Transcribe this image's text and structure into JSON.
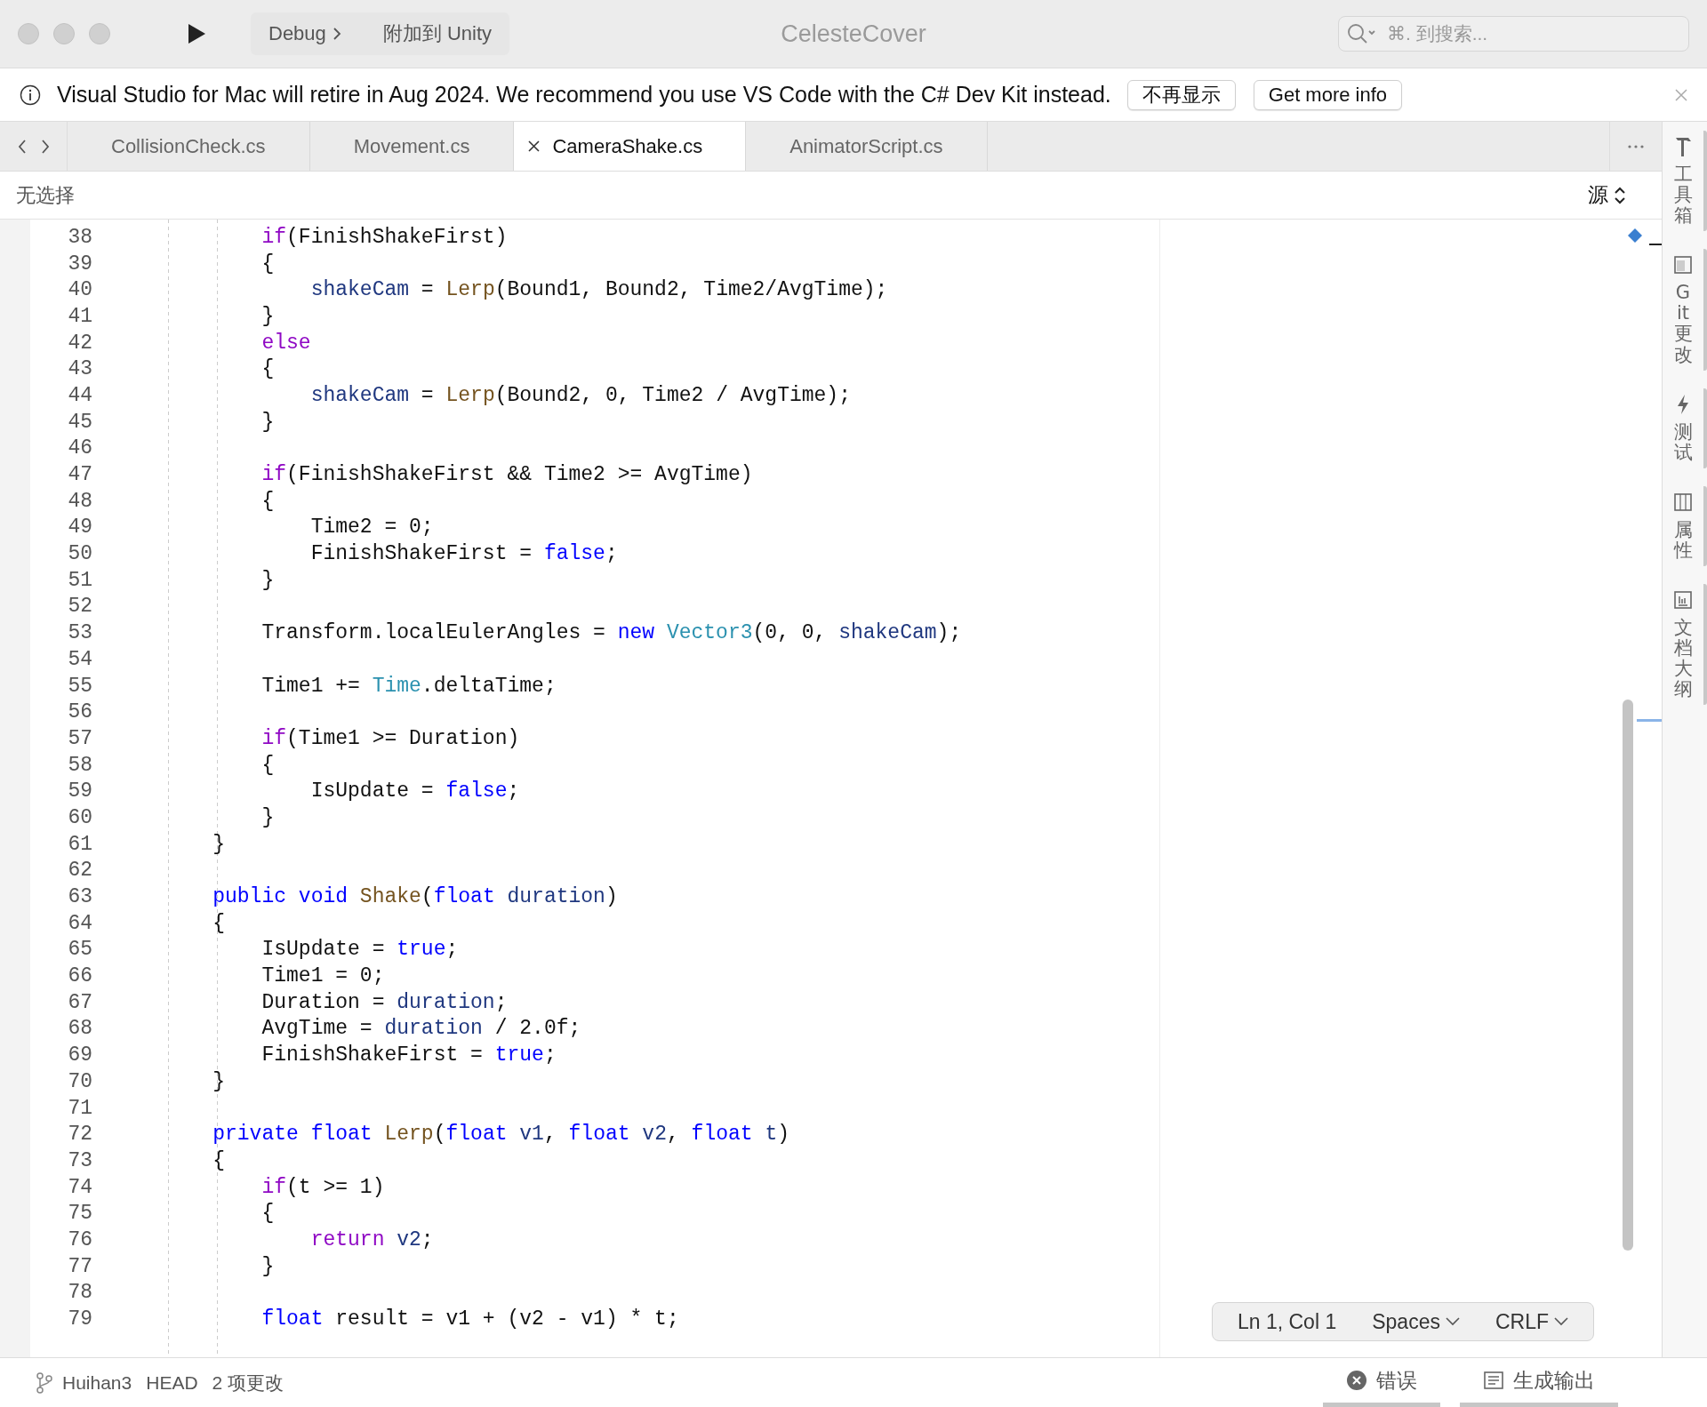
{
  "title_bar": {
    "run_target": "Debug",
    "attach": "附加到 Unity",
    "title": "CelesteCover",
    "search": {
      "placeholder": "⌘. 到搜索..."
    }
  },
  "banner": {
    "message": "Visual Studio for Mac will retire in Aug 2024. We recommend you use VS Code with the C# Dev Kit instead.",
    "buttons": [
      "不再显示",
      "Get more info"
    ]
  },
  "tabs": [
    {
      "label": "CollisionCheck.cs",
      "selected": false
    },
    {
      "label": "Movement.cs",
      "selected": false
    },
    {
      "label": "CameraShake.cs",
      "selected": true
    },
    {
      "label": "AnimatorScript.cs",
      "selected": false
    }
  ],
  "breadcrumb": {
    "selection": "无选择",
    "view": "源"
  },
  "code_lines": [
    {
      "number": "38",
      "tokens": [
        {
          "kind": "kw",
          "text": "        if"
        },
        {
          "kind": "txt",
          "text": "(FinishShakeFirst)"
        }
      ]
    },
    {
      "number": "39",
      "tokens": [
        {
          "kind": "txt",
          "text": "        {"
        }
      ]
    },
    {
      "number": "40",
      "tokens": [
        {
          "kind": "var",
          "text": "            shakeCam"
        },
        {
          "kind": "txt",
          "text": " = "
        },
        {
          "kind": "fn",
          "text": "Lerp"
        },
        {
          "kind": "txt",
          "text": "(Bound1, Bound2, Time2/AvgTime);"
        }
      ]
    },
    {
      "number": "41",
      "tokens": [
        {
          "kind": "txt",
          "text": "        }"
        }
      ]
    },
    {
      "number": "42",
      "tokens": [
        {
          "kind": "kw",
          "text": "        else"
        }
      ]
    },
    {
      "number": "43",
      "tokens": [
        {
          "kind": "txt",
          "text": "        {"
        }
      ]
    },
    {
      "number": "44",
      "tokens": [
        {
          "kind": "var",
          "text": "            shakeCam"
        },
        {
          "kind": "txt",
          "text": " = "
        },
        {
          "kind": "fn",
          "text": "Lerp"
        },
        {
          "kind": "txt",
          "text": "(Bound2, 0, Time2 / AvgTime);"
        }
      ]
    },
    {
      "number": "45",
      "tokens": [
        {
          "kind": "txt",
          "text": "        }"
        }
      ]
    },
    {
      "number": "46"
    },
    {
      "number": "47",
      "tokens": [
        {
          "kind": "kw",
          "text": "        if"
        },
        {
          "kind": "txt",
          "text": "(FinishShakeFirst && Time2 >= AvgTime)"
        }
      ]
    },
    {
      "number": "48",
      "tokens": [
        {
          "kind": "txt",
          "text": "        {"
        }
      ]
    },
    {
      "number": "49",
      "tokens": [
        {
          "kind": "txt",
          "text": "            Time2 = 0;"
        }
      ]
    },
    {
      "number": "50",
      "tokens": [
        {
          "kind": "txt",
          "text": "            FinishShakeFirst = "
        },
        {
          "kind": "key",
          "text": "false"
        },
        {
          "kind": "txt",
          "text": ";"
        }
      ]
    },
    {
      "number": "51",
      "tokens": [
        {
          "kind": "txt",
          "text": "        }"
        }
      ]
    },
    {
      "number": "52"
    },
    {
      "number": "53",
      "tokens": [
        {
          "kind": "txt",
          "text": "        Transform.localEulerAngles = "
        },
        {
          "kind": "key",
          "text": "new "
        },
        {
          "kind": "cls",
          "text": "Vector3"
        },
        {
          "kind": "txt",
          "text": "(0, 0, "
        },
        {
          "kind": "var",
          "text": "shakeCam"
        },
        {
          "kind": "txt",
          "text": ");"
        }
      ]
    },
    {
      "number": "54"
    },
    {
      "number": "55",
      "tokens": [
        {
          "kind": "txt",
          "text": "        Time1 += "
        },
        {
          "kind": "cls",
          "text": "Time"
        },
        {
          "kind": "txt",
          "text": ".deltaTime;"
        }
      ]
    },
    {
      "number": "56"
    },
    {
      "number": "57",
      "tokens": [
        {
          "kind": "kw",
          "text": "        if"
        },
        {
          "kind": "txt",
          "text": "(Time1 >= Duration)"
        }
      ]
    },
    {
      "number": "58",
      "tokens": [
        {
          "kind": "txt",
          "text": "        {"
        }
      ]
    },
    {
      "number": "59",
      "tokens": [
        {
          "kind": "txt",
          "text": "            IsUpdate = "
        },
        {
          "kind": "key",
          "text": "false"
        },
        {
          "kind": "txt",
          "text": ";"
        }
      ]
    },
    {
      "number": "60",
      "tokens": [
        {
          "kind": "txt",
          "text": "        }"
        }
      ]
    },
    {
      "number": "61",
      "tokens": [
        {
          "kind": "txt",
          "text": "    }"
        }
      ]
    },
    {
      "number": "62"
    },
    {
      "number": "63",
      "tokens": [
        {
          "kind": "key",
          "text": "    public void "
        },
        {
          "kind": "fn",
          "text": "Shake"
        },
        {
          "kind": "txt",
          "text": "("
        },
        {
          "kind": "key",
          "text": "float "
        },
        {
          "kind": "var",
          "text": "duration"
        },
        {
          "kind": "txt",
          "text": ")"
        }
      ]
    },
    {
      "number": "64",
      "tokens": [
        {
          "kind": "txt",
          "text": "    {"
        }
      ]
    },
    {
      "number": "65",
      "tokens": [
        {
          "kind": "txt",
          "text": "        IsUpdate = "
        },
        {
          "kind": "key",
          "text": "true"
        },
        {
          "kind": "txt",
          "text": ";"
        }
      ]
    },
    {
      "number": "66",
      "tokens": [
        {
          "kind": "txt",
          "text": "        Time1 = 0;"
        }
      ]
    },
    {
      "number": "67",
      "tokens": [
        {
          "kind": "txt",
          "text": "        Duration = "
        },
        {
          "kind": "var",
          "text": "duration"
        },
        {
          "kind": "txt",
          "text": ";"
        }
      ]
    },
    {
      "number": "68",
      "tokens": [
        {
          "kind": "txt",
          "text": "        AvgTime = "
        },
        {
          "kind": "var",
          "text": "duration"
        },
        {
          "kind": "txt",
          "text": " / 2.0f;"
        }
      ]
    },
    {
      "number": "69",
      "tokens": [
        {
          "kind": "txt",
          "text": "        FinishShakeFirst = "
        },
        {
          "kind": "key",
          "text": "true"
        },
        {
          "kind": "txt",
          "text": ";"
        }
      ]
    },
    {
      "number": "70",
      "tokens": [
        {
          "kind": "txt",
          "text": "    }"
        }
      ]
    },
    {
      "number": "71"
    },
    {
      "number": "72",
      "tokens": [
        {
          "kind": "key",
          "text": "    private float "
        },
        {
          "kind": "fn",
          "text": "Lerp"
        },
        {
          "kind": "txt",
          "text": "("
        },
        {
          "kind": "key",
          "text": "float "
        },
        {
          "kind": "var",
          "text": "v1"
        },
        {
          "kind": "txt",
          "text": ", "
        },
        {
          "kind": "key",
          "text": "float "
        },
        {
          "kind": "var",
          "text": "v2"
        },
        {
          "kind": "txt",
          "text": ", "
        },
        {
          "kind": "key",
          "text": "float "
        },
        {
          "kind": "var",
          "text": "t"
        },
        {
          "kind": "txt",
          "text": ")"
        }
      ]
    },
    {
      "number": "73",
      "tokens": [
        {
          "kind": "txt",
          "text": "    {"
        }
      ]
    },
    {
      "number": "74",
      "tokens": [
        {
          "kind": "kw",
          "text": "        if"
        },
        {
          "kind": "txt",
          "text": "(t >= 1)"
        }
      ]
    },
    {
      "number": "75",
      "tokens": [
        {
          "kind": "txt",
          "text": "        {"
        }
      ]
    },
    {
      "number": "76",
      "tokens": [
        {
          "kind": "kw",
          "text": "            return "
        },
        {
          "kind": "var",
          "text": "v2"
        },
        {
          "kind": "txt",
          "text": ";"
        }
      ]
    },
    {
      "number": "77",
      "tokens": [
        {
          "kind": "txt",
          "text": "        }"
        }
      ]
    },
    {
      "number": "78"
    },
    {
      "number": "79",
      "tokens": [
        {
          "kind": "key",
          "text": "        float "
        },
        {
          "kind": "txt",
          "text": "result = v1 + (v2 - v1) * t;"
        }
      ]
    }
  ],
  "editor_status": {
    "position": "Ln 1, Col 1",
    "indentation": "Spaces",
    "line_ending": "CRLF"
  },
  "side_panels": [
    {
      "kind": "hammer",
      "label": "工具箱"
    },
    {
      "kind": "panel",
      "label": "Git 更改"
    },
    {
      "kind": "bolt",
      "label": "测试"
    },
    {
      "kind": "grid",
      "label": "属性"
    },
    {
      "kind": "chart",
      "label": "文档大纲"
    }
  ],
  "status_bar": {
    "branch": "Huihan3",
    "head": "HEAD",
    "changes": "2 项更改",
    "pads": [
      {
        "kind": "errors",
        "label": "错误"
      },
      {
        "kind": "output",
        "label": "生成输出"
      }
    ]
  }
}
